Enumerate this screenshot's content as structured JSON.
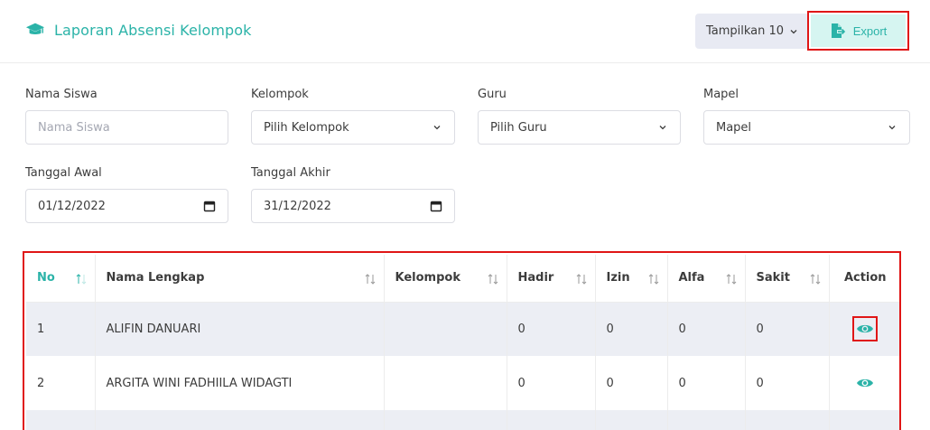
{
  "header": {
    "title": "Laporan Absensi Kelompok",
    "title_icon": "graduation-cap-icon",
    "show_button_label": "Tampilkan 10",
    "export_label": "Export"
  },
  "filters": {
    "nama_siswa": {
      "label": "Nama Siswa",
      "placeholder": "Nama Siswa"
    },
    "kelompok": {
      "label": "Kelompok",
      "selected": "Pilih Kelompok"
    },
    "guru": {
      "label": "Guru",
      "selected": "Pilih Guru"
    },
    "mapel": {
      "label": "Mapel",
      "selected": "Mapel"
    },
    "tanggal_awal": {
      "label": "Tanggal Awal",
      "value": "01/12/2022"
    },
    "tanggal_akhir": {
      "label": "Tanggal Akhir",
      "value": "31/12/2022"
    }
  },
  "table": {
    "columns": [
      "No",
      "Nama Lengkap",
      "Kelompok",
      "Hadir",
      "Izin",
      "Alfa",
      "Sakit",
      "Action"
    ],
    "rows": [
      {
        "no": "1",
        "nama": "ALIFIN DANUARI",
        "kelompok": "",
        "hadir": "0",
        "izin": "0",
        "alfa": "0",
        "sakit": "0"
      },
      {
        "no": "2",
        "nama": "ARGITA WINI FADHIILA WIDAGTI",
        "kelompok": "",
        "hadir": "0",
        "izin": "0",
        "alfa": "0",
        "sakit": "0"
      }
    ]
  },
  "colors": {
    "accent": "#2bb3a8",
    "highlight_border": "#e01616",
    "row_alt": "#eceef4"
  }
}
